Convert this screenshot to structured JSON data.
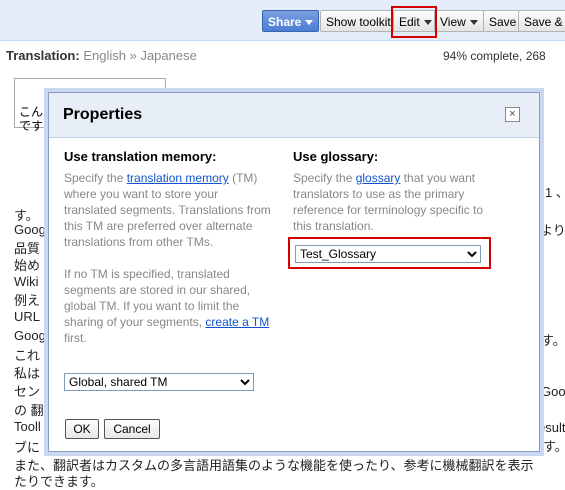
{
  "toolbar": {
    "share": "Share",
    "show_toolkit": "Show toolkit",
    "edit": "Edit",
    "view": "View",
    "save": "Save",
    "save_close": "Save & C"
  },
  "header": {
    "title": "Translation:",
    "source_lang": "English",
    "sep": "»",
    "target_lang": "Japanese",
    "progress": "94% complete, 268"
  },
  "background": {
    "box_text1": "こん",
    "box_text2": "です",
    "lines": [
      "す。",
      "Goog",
      "品質",
      "始め",
      "Wiki",
      "例え",
      "URL",
      "Goog",
      "これ",
      "私は",
      "セン",
      "の 翻",
      "Tooll",
      "ブに",
      "また、翻訳者はカスタムの多言語用語集のような機能を使ったり、参考に機械翻訳を表示",
      "たりできます。"
    ],
    "right_fragments": [
      "1 、",
      "より",
      "す。",
      "Goo",
      "ます。",
      "esult"
    ]
  },
  "dialog": {
    "title": "Properties",
    "close": "×",
    "tm": {
      "heading": "Use translation memory:",
      "p1_pre": "Specify the ",
      "p1_link": "translation memory",
      "p1_post": " (TM) where you want to store your translated segments. Translations from this TM are preferred over alternate translations from other TMs.",
      "p2_pre": "If no TM is specified, translated segments are stored in our shared, global TM. If you want to limit the sharing of your segments, ",
      "p2_link": "create a TM",
      "p2_post": " first.",
      "selected": "Global, shared TM"
    },
    "glossary": {
      "heading": "Use glossary:",
      "p_pre": "Specify the ",
      "p_link": "glossary",
      "p_post": " that you want translators to use as the primary reference for terminology specific to this translation.",
      "selected": "Test_Glossary"
    },
    "ok": "OK",
    "cancel": "Cancel"
  },
  "colors": {
    "highlight": "#d40000",
    "toolbar_bg": "#e5ecf9",
    "link": "#15c"
  }
}
